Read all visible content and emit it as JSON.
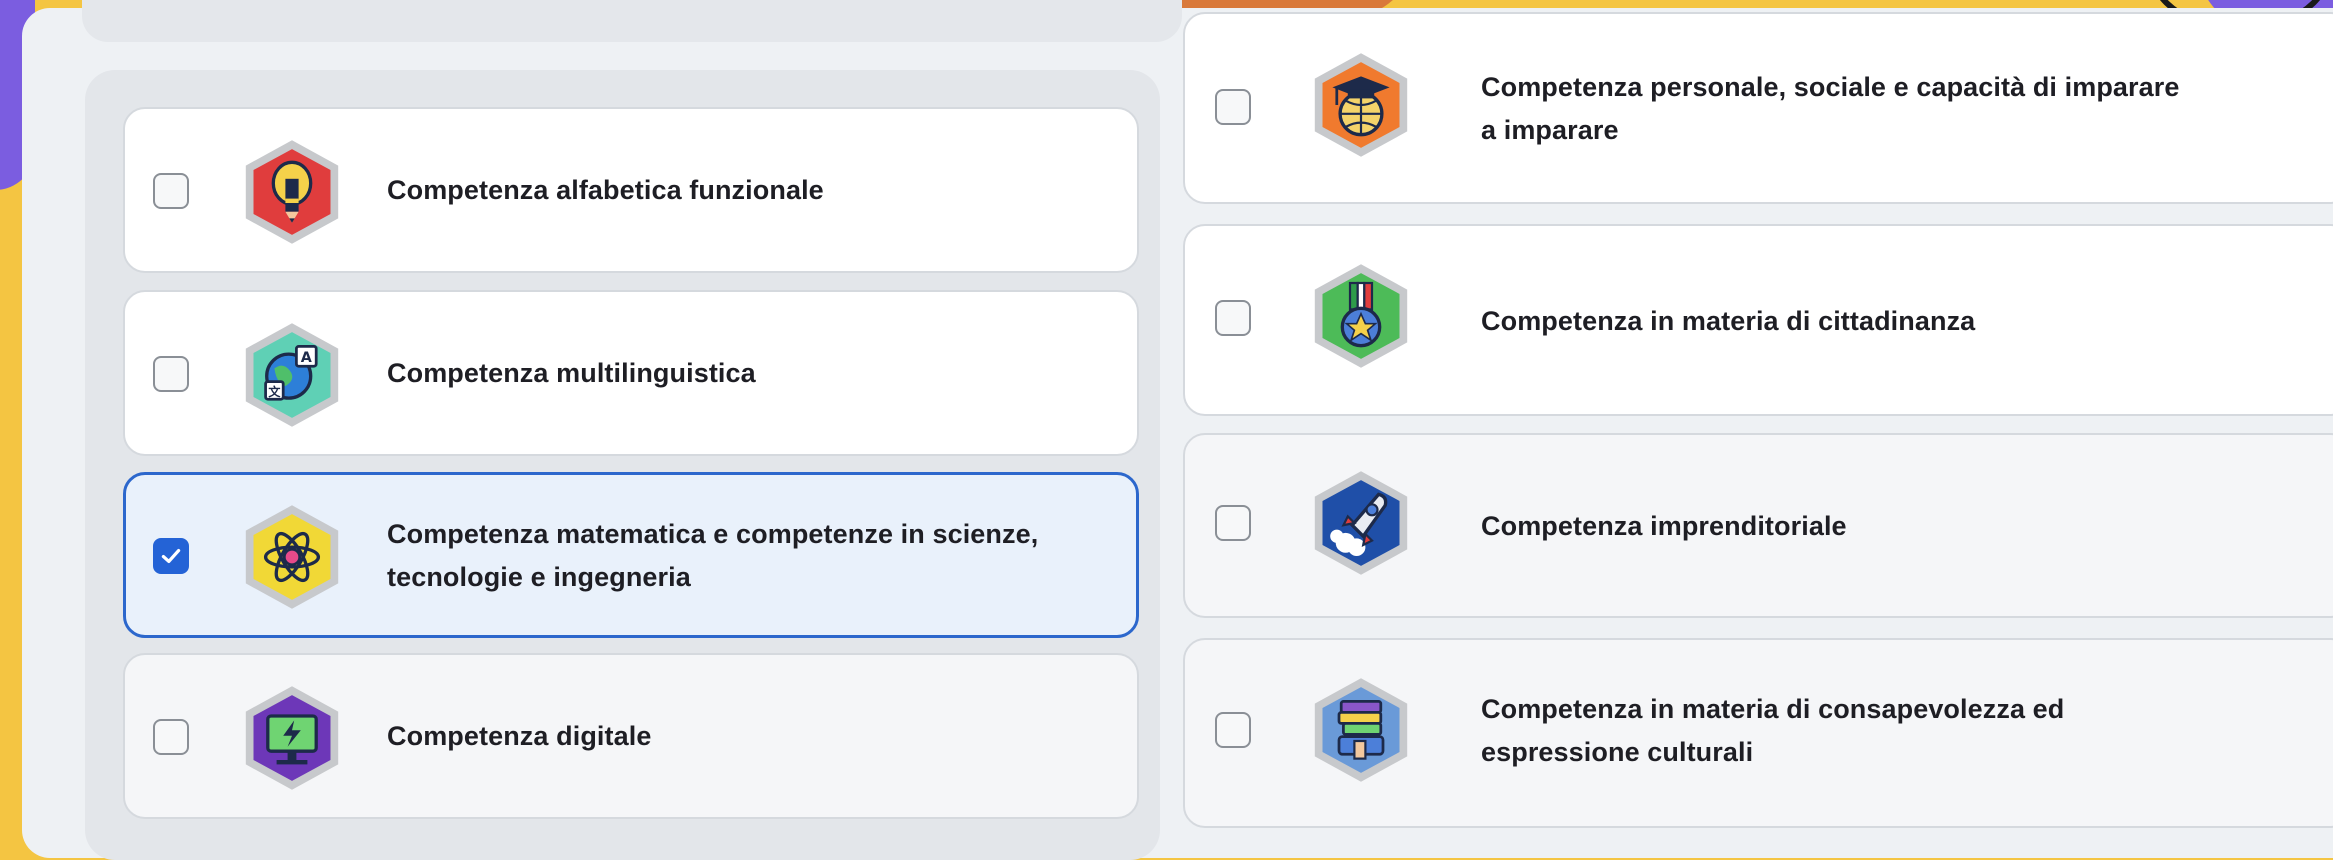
{
  "competencies_left": [
    {
      "label_line1": "Competenza alfabetica funzionale",
      "label_line2": "",
      "checked": false,
      "badge_color": "#e03d3d",
      "icon": "lightbulb-pencil-icon"
    },
    {
      "label_line1": "Competenza multilinguistica",
      "label_line2": "",
      "checked": false,
      "badge_color": "#5fd0b5",
      "icon": "globe-translate-icon"
    },
    {
      "label_line1": "Competenza matematica e competenze in scienze,",
      "label_line2": "tecnologie e ingegneria",
      "checked": true,
      "badge_color": "#f1d836",
      "icon": "atom-icon"
    },
    {
      "label_line1": "Competenza digitale",
      "label_line2": "",
      "checked": false,
      "badge_color": "#6d37b8",
      "icon": "computer-lightning-icon"
    }
  ],
  "competencies_right": [
    {
      "label_line1": "Competenza personale, sociale e capacità di imparare",
      "label_line2": "a imparare",
      "checked": false,
      "badge_color": "#f07a2e",
      "icon": "graduation-cap-globe-icon"
    },
    {
      "label_line1": "Competenza in materia di cittadinanza",
      "label_line2": "",
      "checked": false,
      "badge_color": "#4dbb58",
      "icon": "medal-star-icon"
    },
    {
      "label_line1": "Competenza imprenditoriale",
      "label_line2": "",
      "checked": false,
      "badge_color": "#1f4fa8",
      "icon": "rocket-icon"
    },
    {
      "label_line1": "Competenza in materia di consapevolezza ed",
      "label_line2": "espressione culturali",
      "checked": false,
      "badge_color": "#6a9ad8",
      "icon": "books-scroll-icon"
    }
  ]
}
